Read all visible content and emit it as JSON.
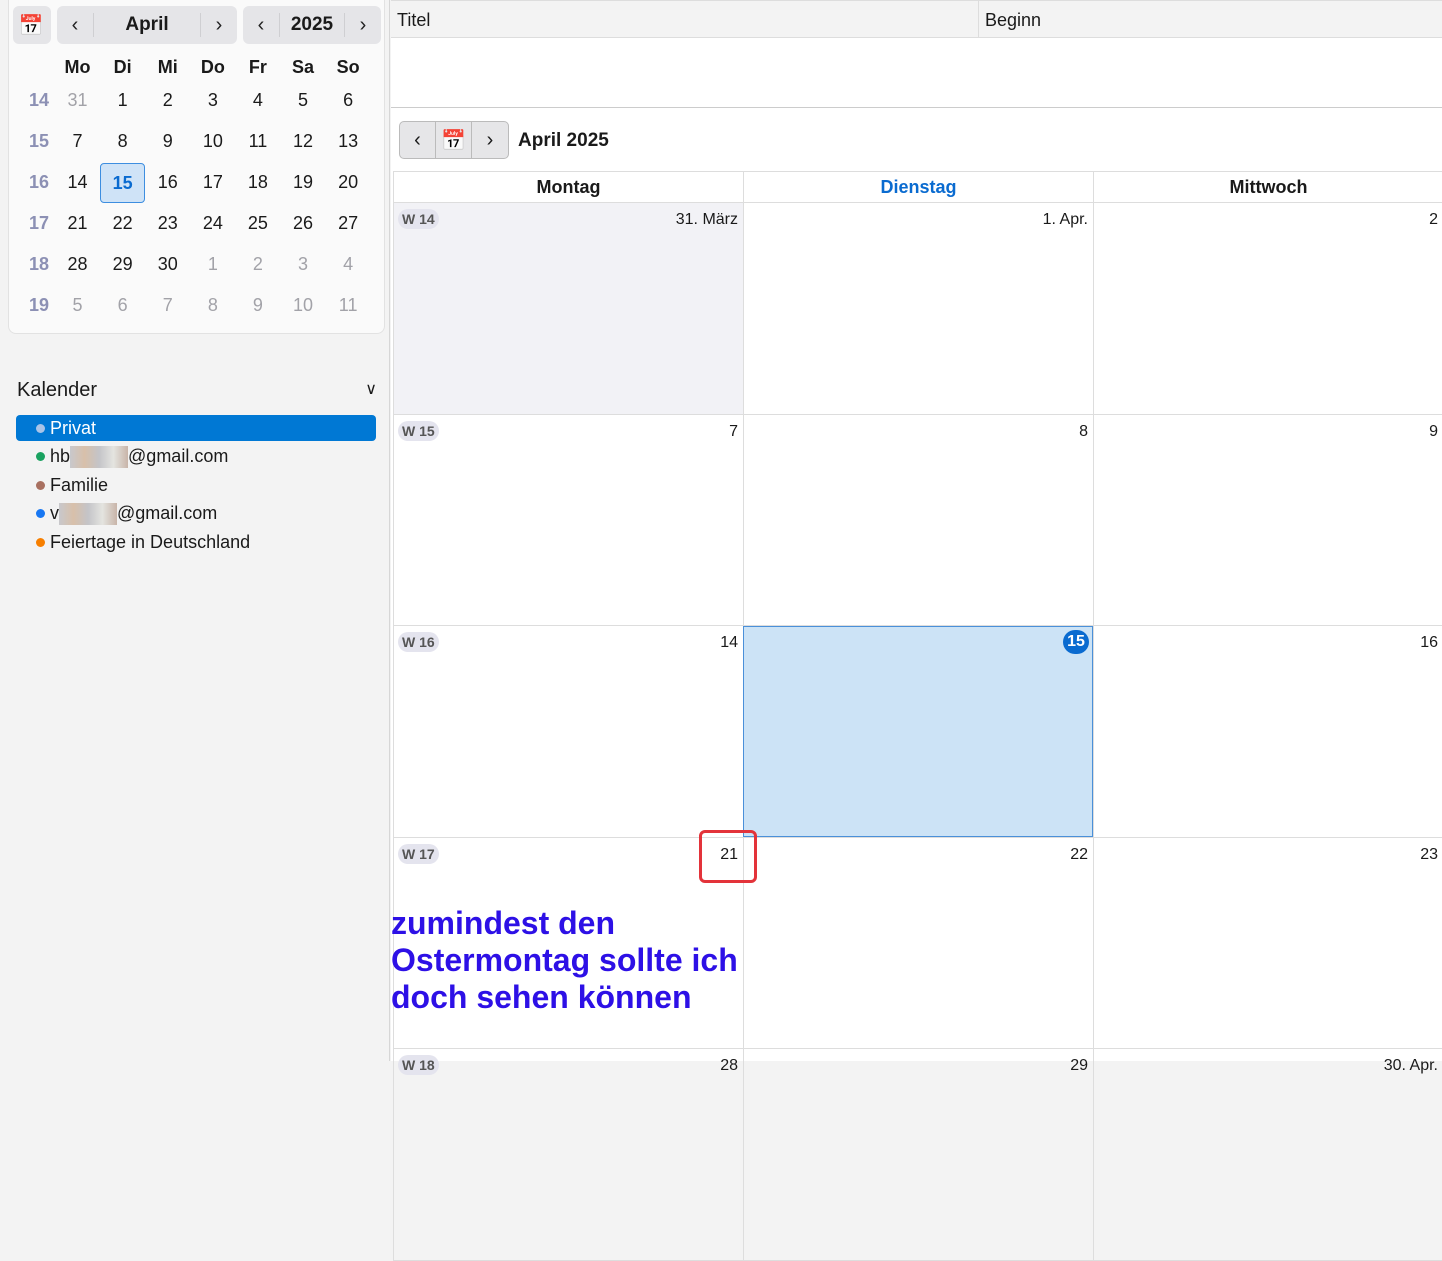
{
  "mini": {
    "month": "April",
    "year": "2025",
    "weekdays": [
      "Mo",
      "Di",
      "Mi",
      "Do",
      "Fr",
      "Sa",
      "So"
    ],
    "weeks": [
      {
        "wk": "14",
        "days": [
          "31",
          "1",
          "2",
          "3",
          "4",
          "5",
          "6"
        ]
      },
      {
        "wk": "15",
        "days": [
          "7",
          "8",
          "9",
          "10",
          "11",
          "12",
          "13"
        ]
      },
      {
        "wk": "16",
        "days": [
          "14",
          "15",
          "16",
          "17",
          "18",
          "19",
          "20"
        ]
      },
      {
        "wk": "17",
        "days": [
          "21",
          "22",
          "23",
          "24",
          "25",
          "26",
          "27"
        ]
      },
      {
        "wk": "18",
        "days": [
          "28",
          "29",
          "30",
          "1",
          "2",
          "3",
          "4"
        ]
      },
      {
        "wk": "19",
        "days": [
          "5",
          "6",
          "7",
          "8",
          "9",
          "10",
          "11"
        ]
      }
    ]
  },
  "kalender": {
    "title": "Kalender",
    "items": [
      {
        "label": "Privat",
        "color": "#a9c4e8"
      },
      {
        "prefix": "hb",
        "suffix": "@gmail.com",
        "color": "#1aa260"
      },
      {
        "label": "Familie",
        "color": "#a87060"
      },
      {
        "prefix": "v",
        "suffix": "@gmail.com",
        "color": "#1877f2"
      },
      {
        "label": "Feiertage in Deutschland",
        "color": "#f77f00"
      }
    ]
  },
  "list": {
    "col_title": "Titel",
    "col_begin": "Beginn"
  },
  "view": {
    "title": "April 2025",
    "days": [
      "Montag",
      "Dienstag",
      "Mittwoch"
    ],
    "rows": [
      {
        "wk": "W 14",
        "cells": [
          "31. März",
          "1. Apr.",
          "2"
        ]
      },
      {
        "wk": "W 15",
        "cells": [
          "7",
          "8",
          "9"
        ]
      },
      {
        "wk": "W 16",
        "cells": [
          "14",
          "15",
          "16"
        ]
      },
      {
        "wk": "W 17",
        "cells": [
          "21",
          "22",
          "23"
        ]
      },
      {
        "wk": "W 18",
        "cells": [
          "28",
          "29",
          "30. Apr."
        ]
      }
    ]
  },
  "annotation": "zumindest den Ostermontag sollte ich doch sehen können"
}
